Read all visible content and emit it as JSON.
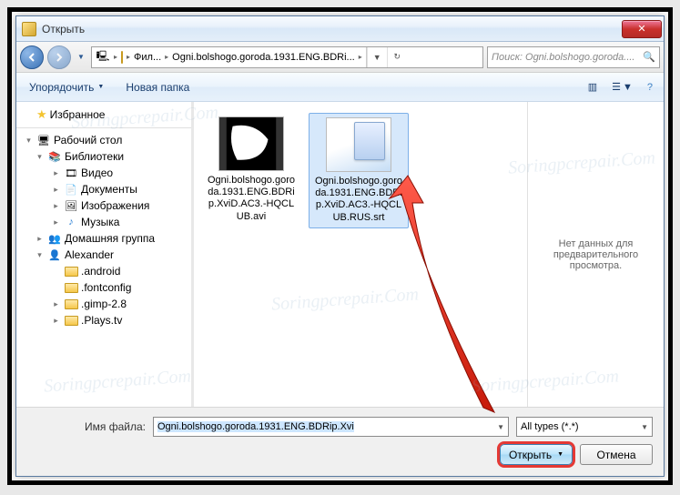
{
  "titlebar": {
    "title": "Открыть"
  },
  "nav": {
    "breadcrumb_seg1": "Фил...",
    "breadcrumb_seg2": "Ogni.bolshogo.goroda.1931.ENG.BDRi...",
    "search_placeholder": "Поиск: Ogni.bolshogo.goroda...."
  },
  "toolbar": {
    "organize": "Упорядочить",
    "new_folder": "Новая папка"
  },
  "sidebar": {
    "favorites": "Избранное",
    "desktop": "Рабочий стол",
    "libraries": "Библиотеки",
    "video": "Видео",
    "documents": "Документы",
    "pictures": "Изображения",
    "music": "Музыка",
    "homegroup": "Домашняя группа",
    "user": "Alexander",
    "f1": ".android",
    "f2": ".fontconfig",
    "f3": ".gimp-2.8",
    "f4": ".Plays.tv"
  },
  "files": {
    "file1": "Ogni.bolshogo.goroda.1931.ENG.BDRip.XviD.AC3.-HQCLUB.avi",
    "file2": "Ogni.bolshogo.goroda.1931.ENG.BDRip.XviD.AC3.-HQCLUB.RUS.srt"
  },
  "preview": {
    "text": "Нет данных для предварительного просмотра."
  },
  "bottom": {
    "filename_label": "Имя файла:",
    "filename_value": "Ogni.bolshogo.goroda.1931.ENG.BDRip.Xvi",
    "filter_value": "All types (*.*)",
    "open_btn": "Открыть",
    "cancel_btn": "Отмена"
  },
  "watermark": "Soringpcrepair.Com"
}
